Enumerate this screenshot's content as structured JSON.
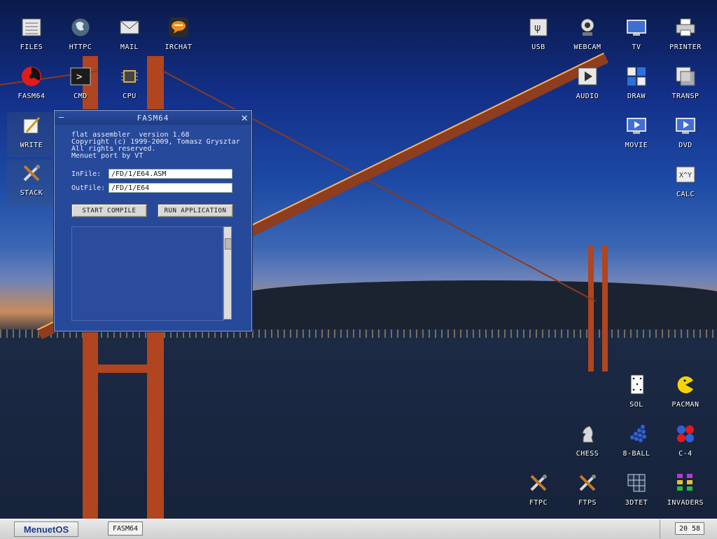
{
  "desktop": {
    "icons_left": [
      {
        "label": "FILES",
        "icon": "files-icon"
      },
      {
        "label": "HTTPC",
        "icon": "globe-icon"
      },
      {
        "label": "MAIL",
        "icon": "mail-icon"
      },
      {
        "label": "IRCHAT",
        "icon": "chat-icon"
      },
      {
        "label": "FASM64",
        "icon": "radiation-icon"
      },
      {
        "label": "CMD",
        "icon": "terminal-icon"
      },
      {
        "label": "CPU",
        "icon": "chip-icon"
      },
      {
        "label": "WRITE",
        "icon": "write-icon"
      },
      {
        "label": "STACK",
        "icon": "tools-icon"
      }
    ],
    "icons_right": [
      {
        "label": "USB",
        "icon": "usb-icon"
      },
      {
        "label": "WEBCAM",
        "icon": "webcam-icon"
      },
      {
        "label": "TV",
        "icon": "tv-icon"
      },
      {
        "label": "PRINTER",
        "icon": "printer-icon"
      },
      {
        "label": "AUDIO",
        "icon": "audio-icon"
      },
      {
        "label": "DRAW",
        "icon": "draw-icon"
      },
      {
        "label": "TRANSP",
        "icon": "transparency-icon"
      },
      {
        "label": "MOVIE",
        "icon": "movie-icon"
      },
      {
        "label": "DVD",
        "icon": "dvd-icon"
      },
      {
        "label": "CALC",
        "icon": "calculator-icon"
      }
    ],
    "icons_bottom": [
      {
        "label": "SOL",
        "icon": "cards-icon"
      },
      {
        "label": "PACMAN",
        "icon": "pacman-icon"
      },
      {
        "label": "CHESS",
        "icon": "chess-knight-icon"
      },
      {
        "label": "8-BALL",
        "icon": "billiards-icon"
      },
      {
        "label": "C-4",
        "icon": "connect4-icon"
      },
      {
        "label": "FTPC",
        "icon": "tools-icon"
      },
      {
        "label": "FTPS",
        "icon": "tools-icon"
      },
      {
        "label": "3DTET",
        "icon": "tetris-icon"
      },
      {
        "label": "INVADERS",
        "icon": "invaders-icon"
      }
    ]
  },
  "window": {
    "title": "FASM64",
    "info_lines": [
      "flat assembler  version 1.68",
      "Copyright (c) 1999-2009, Tomasz Grysztar",
      "All rights reserved.",
      "Menuet port by VT"
    ],
    "infile_label": "InFile:",
    "infile_value": "/FD/1/E64.ASM",
    "outfile_label": "OutFile:",
    "outfile_value": "/FD/1/E64",
    "start_button": "START COMPILE",
    "run_button": "RUN APPLICATION"
  },
  "taskbar": {
    "start_label": "MenuetOS",
    "task_label": "FASM64",
    "clock": "20 58"
  },
  "colors": {
    "window_bg": "#27499a",
    "taskbar_bg": "#d9d9d9"
  }
}
